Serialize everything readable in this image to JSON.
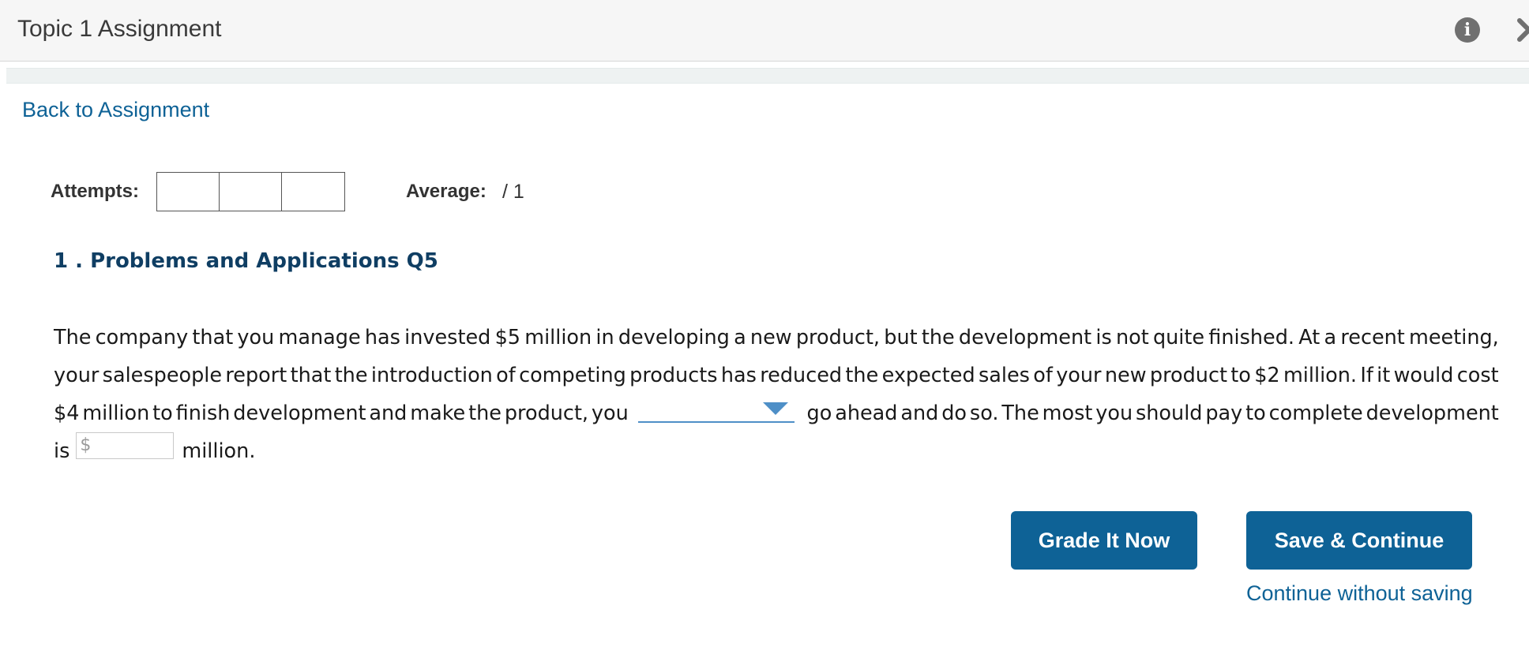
{
  "window": {
    "title": "Topic 1 Assignment"
  },
  "nav": {
    "back_label": "Back to Assignment"
  },
  "attempts": {
    "label": "Attempts:",
    "boxes": [
      "",
      "",
      ""
    ]
  },
  "average": {
    "label": "Average:",
    "value": "/ 1"
  },
  "question": {
    "title": "1 . Problems and Applications Q5",
    "line1": [
      "The",
      "company",
      "that",
      "you",
      "manage",
      "has",
      "invested",
      "$5",
      "million",
      "in",
      "developing",
      "a",
      "new",
      "product,",
      "but",
      "the",
      "development",
      "is",
      "not",
      "quite",
      "finished.",
      "At",
      "a",
      "recent",
      "meeting,"
    ],
    "line2": [
      "your",
      "salespeople",
      "report",
      "that",
      "the",
      "introduction",
      "of",
      "competing",
      "products",
      "has",
      "reduced",
      "the",
      "expected",
      "sales",
      "of",
      "your",
      "new",
      "product",
      "to",
      "$2",
      "million.",
      "If",
      "it",
      "would",
      "cost"
    ],
    "line3_before": [
      "$4",
      "million",
      "to",
      "finish",
      "development",
      "and",
      "make",
      "the",
      "product,",
      "you"
    ],
    "line3_after": [
      "go",
      "ahead",
      "and",
      "do",
      "so.",
      "The",
      "most",
      "you",
      "should",
      "pay",
      "to",
      "complete",
      "development"
    ],
    "line4_before": "is",
    "line4_after": "million.",
    "dropdown_value": "",
    "money_input": {
      "currency_symbol": "$",
      "value": ""
    }
  },
  "buttons": {
    "grade_label": "Grade It Now",
    "save_label": "Save & Continue",
    "continue_label": "Continue without saving"
  },
  "colors": {
    "accent": "#0e6296",
    "title_blue": "#0f3e63",
    "dropdown_line": "#4e8fc7"
  },
  "icons": {
    "info": "info-icon",
    "close": "close-icon",
    "caret": "caret-down-icon"
  }
}
